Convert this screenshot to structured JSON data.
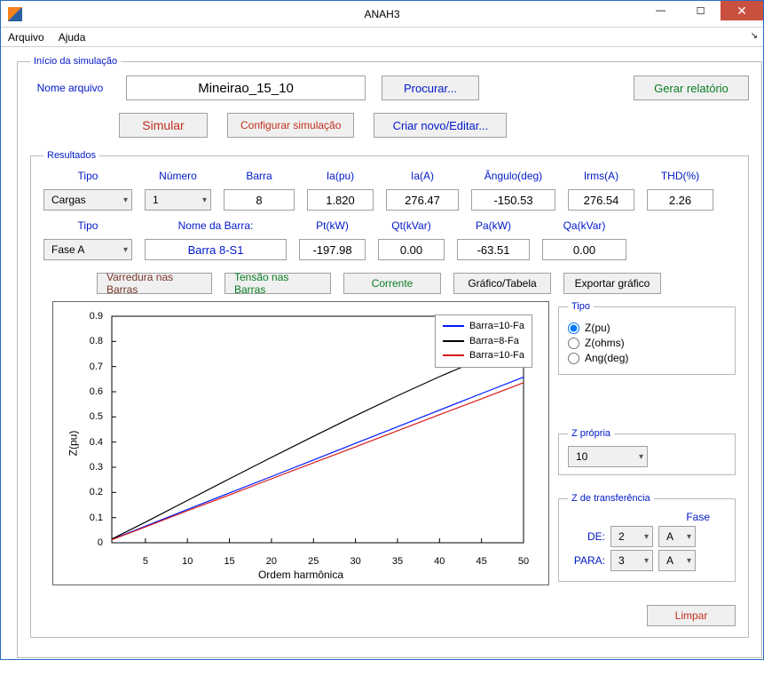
{
  "window": {
    "title": "ANAH3"
  },
  "menu": {
    "arquivo": "Arquivo",
    "ajuda": "Ajuda"
  },
  "inicio": {
    "legend": "Início da simulação",
    "nome_arquivo_label": "Nome arquivo",
    "nome_arquivo_value": "Mineirao_15_10",
    "procurar": "Procurar...",
    "gerar_relatorio": "Gerar relatório",
    "simular": "Simular",
    "configurar": "Configurar simulação",
    "criar_novo": "Criar novo/Editar..."
  },
  "resultados": {
    "legend": "Resultados",
    "headers1": {
      "tipo": "Tipo",
      "numero": "Número",
      "barra": "Barra",
      "iapu": "Ia(pu)",
      "iaa": "Ia(A)",
      "angulo": "Ângulo(deg)",
      "irms": "Irms(A)",
      "thd": "THD(%)"
    },
    "row1": {
      "tipo": "Cargas",
      "numero": "1",
      "barra": "8",
      "iapu": "1.820",
      "iaa": "276.47",
      "angulo": "-150.53",
      "irms": "276.54",
      "thd": "2.26"
    },
    "headers2": {
      "tipo": "Tipo",
      "nome_barra": "Nome da Barra:",
      "pt": "Pt(kW)",
      "qt": "Qt(kVar)",
      "pa": "Pa(kW)",
      "qa": "Qa(kVar)"
    },
    "row2": {
      "fase": "Fase A",
      "nome_barra": "Barra  8-S1",
      "pt": "-197.98",
      "qt": "0.00",
      "pa": "-63.51",
      "qa": "0.00"
    },
    "tabs": {
      "varredura": "Varredura nas Barras",
      "tensao": "Tensão nas Barras",
      "corrente": "Corrente",
      "grafico": "Gráfico/Tabela",
      "exportar": "Exportar gráfico"
    }
  },
  "chart_data": {
    "type": "line",
    "title": "",
    "xlabel": "Ordem harmônica",
    "ylabel": "Z(pu)",
    "xlim": [
      1,
      50
    ],
    "ylim": [
      0,
      0.9
    ],
    "xticks": [
      5,
      10,
      15,
      20,
      25,
      30,
      35,
      40,
      45,
      50
    ],
    "yticks": [
      0,
      0.1,
      0.2,
      0.3,
      0.4,
      0.5,
      0.6,
      0.7,
      0.8,
      0.9
    ],
    "legend_position": "top-right",
    "series": [
      {
        "name": "Barra=10-Fa",
        "color": "#0018ff",
        "x": [
          1,
          5,
          10,
          15,
          20,
          25,
          30,
          35,
          40,
          45,
          50
        ],
        "y": [
          0.013,
          0.066,
          0.132,
          0.198,
          0.263,
          0.329,
          0.395,
          0.461,
          0.527,
          0.593,
          0.658
        ]
      },
      {
        "name": "Barra=8-Fa",
        "color": "#000000",
        "x": [
          1,
          5,
          10,
          15,
          20,
          25,
          30,
          35,
          40,
          45,
          50
        ],
        "y": [
          0.015,
          0.082,
          0.168,
          0.254,
          0.339,
          0.423,
          0.505,
          0.584,
          0.66,
          0.731,
          0.798
        ]
      },
      {
        "name": "Barra=10-Fa",
        "color": "#d81a1a",
        "x": [
          1,
          5,
          10,
          15,
          20,
          25,
          30,
          35,
          40,
          45,
          50
        ],
        "y": [
          0.012,
          0.063,
          0.127,
          0.19,
          0.254,
          0.318,
          0.381,
          0.445,
          0.509,
          0.572,
          0.636
        ]
      }
    ]
  },
  "side": {
    "tipo_legend": "Tipo",
    "radio": {
      "zpu": "Z(pu)",
      "zohms": "Z(ohms)",
      "ang": "Ang(deg)"
    },
    "zpropria_legend": "Z própria",
    "zpropria_value": "10",
    "ztransf_legend": "Z de transferência",
    "fase_label": "Fase",
    "de_label": "DE:",
    "de_value": "2",
    "de_fase": "A",
    "para_label": "PARA:",
    "para_value": "3",
    "para_fase": "A",
    "limpar": "Limpar"
  }
}
